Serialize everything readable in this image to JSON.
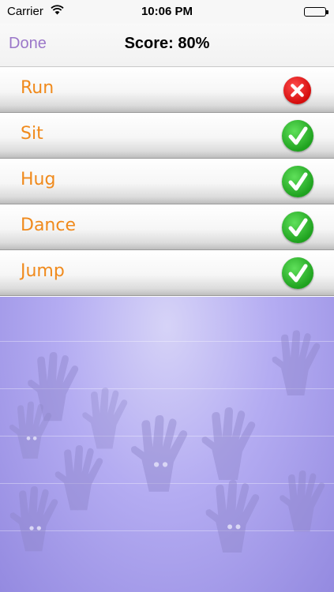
{
  "status_bar": {
    "carrier": "Carrier",
    "time": "10:06 PM",
    "wifi_icon": "wifi-icon",
    "battery_icon": "battery-icon"
  },
  "nav_bar": {
    "done_label": "Done",
    "score_text": "Score: 80%"
  },
  "results": [
    {
      "word": "Run",
      "correct": false,
      "icon": "cross-icon"
    },
    {
      "word": "Sit",
      "correct": true,
      "icon": "check-icon"
    },
    {
      "word": "Hug",
      "correct": true,
      "icon": "check-icon"
    },
    {
      "word": "Dance",
      "correct": true,
      "icon": "check-icon"
    },
    {
      "word": "Jump",
      "correct": true,
      "icon": "check-icon"
    }
  ],
  "colors": {
    "accent_done": "#9b77c9",
    "word_text": "#f08a1c",
    "correct": "#1fa21f",
    "wrong": "#d40c0c",
    "background": "#b4acf2"
  }
}
